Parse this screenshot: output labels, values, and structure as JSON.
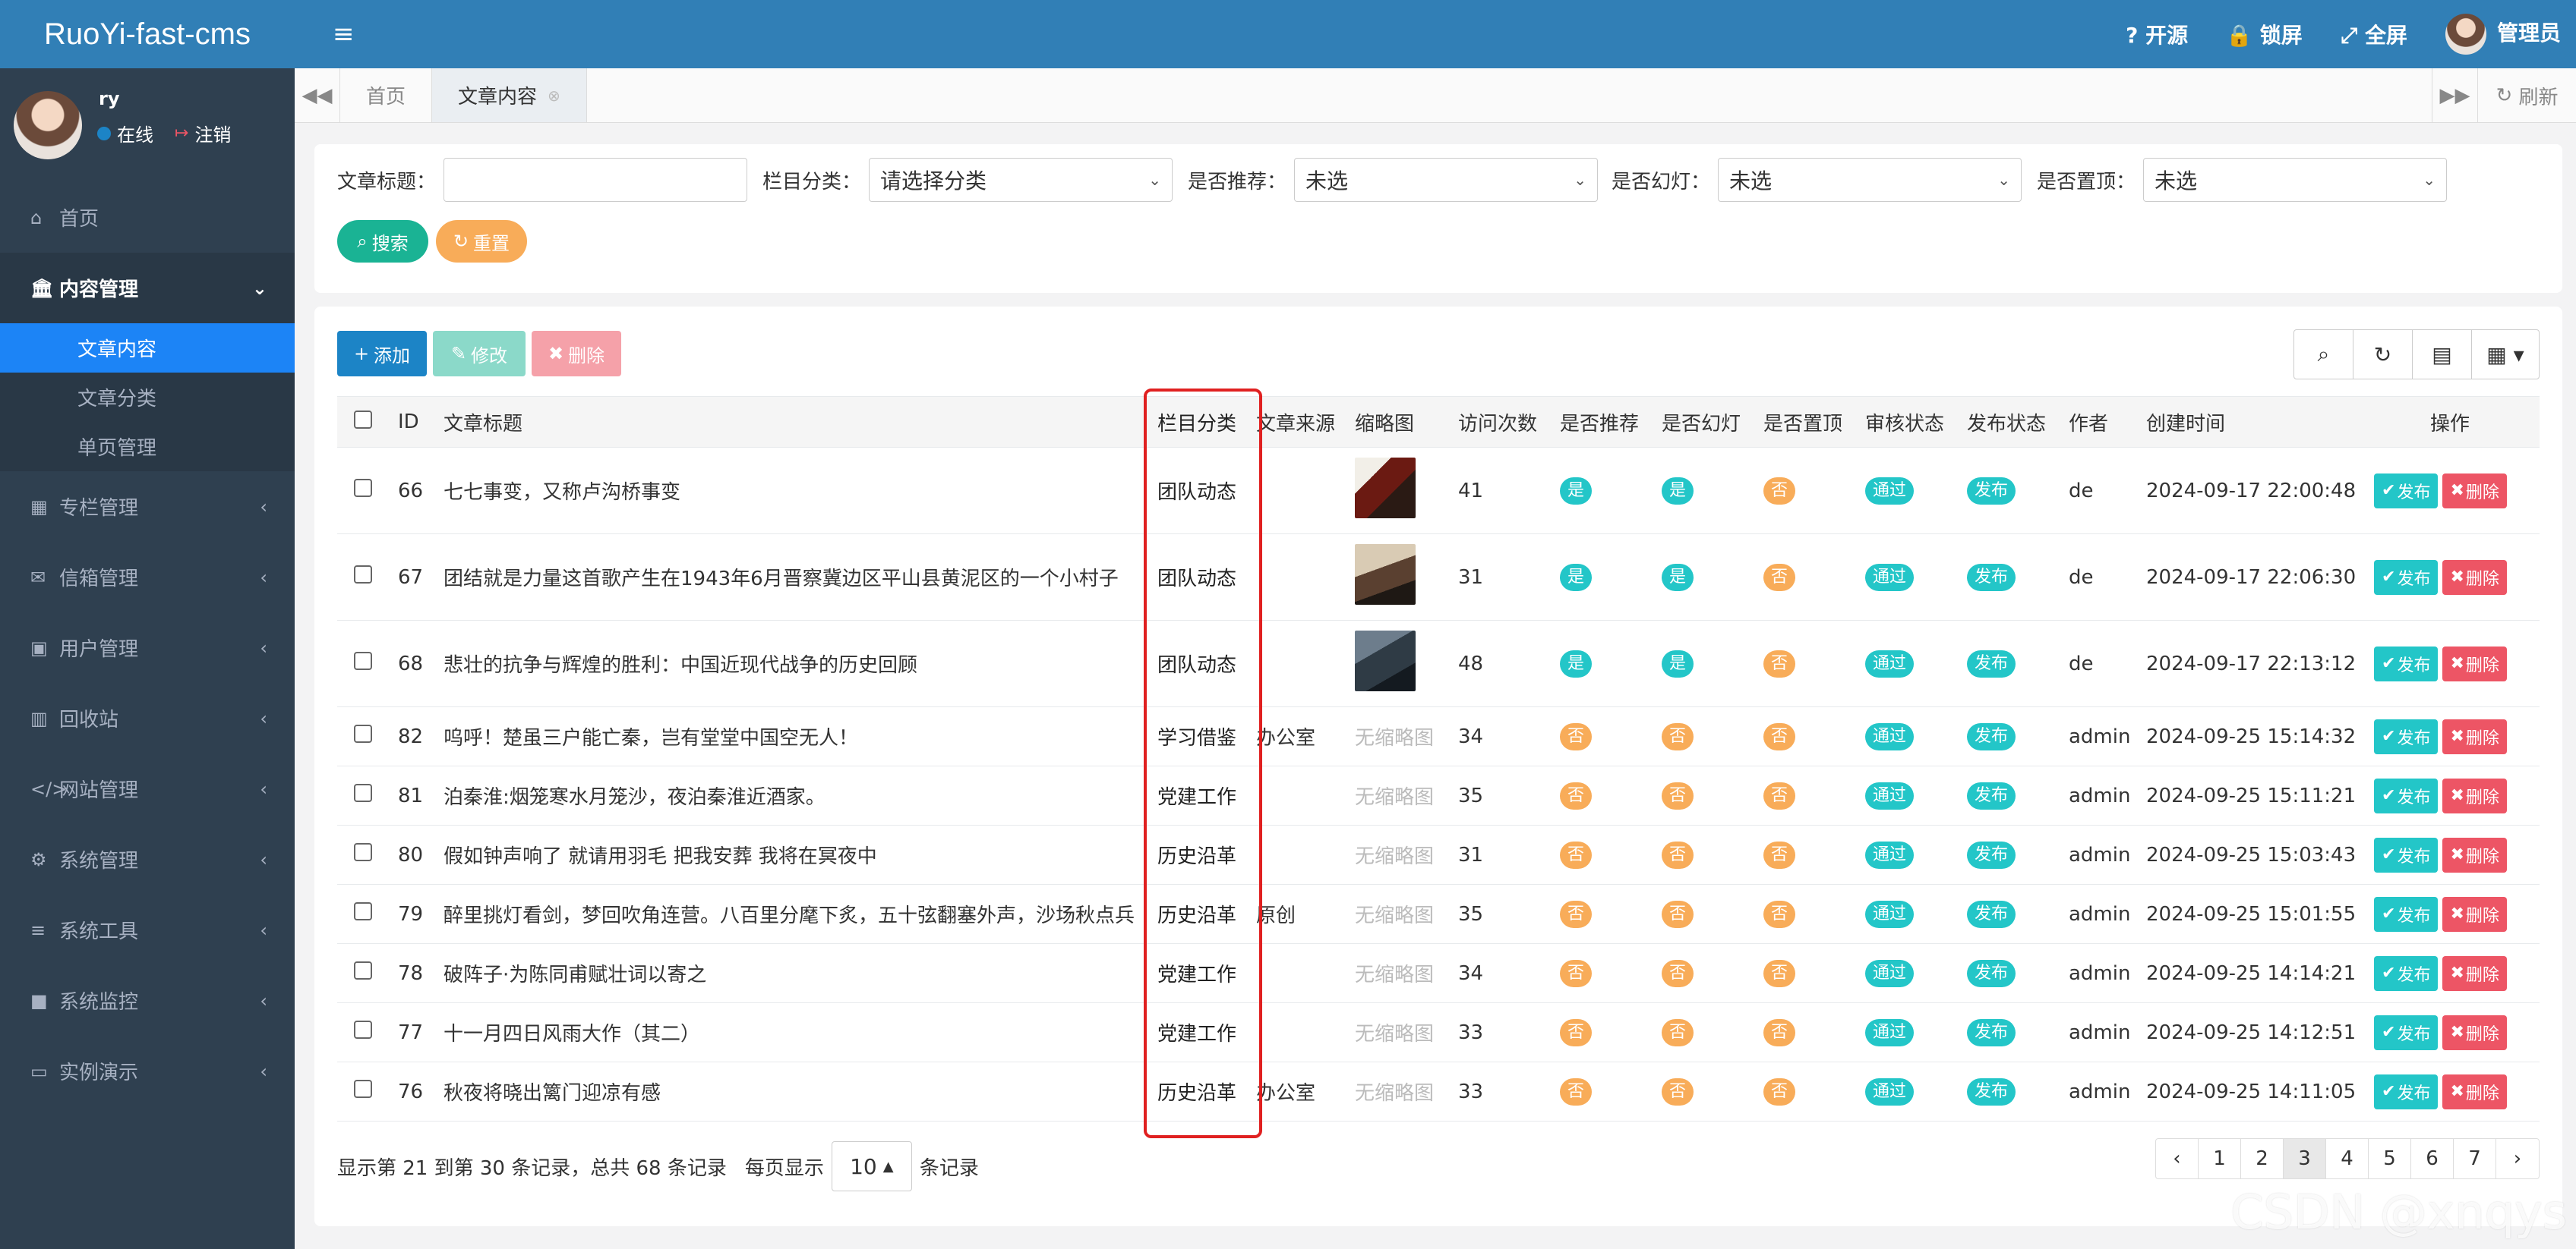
{
  "app": {
    "logo": "RuoYi-fast-cms"
  },
  "user": {
    "name": "ry",
    "status": "在线",
    "logout": "注销"
  },
  "sidebar": {
    "home": "首页",
    "content": "内容管理",
    "content_sub": [
      "文章内容",
      "文章分类",
      "单页管理"
    ],
    "items": [
      "专栏管理",
      "信箱管理",
      "用户管理",
      "回收站",
      "网站管理",
      "系统管理",
      "系统工具",
      "系统监控",
      "实例演示"
    ]
  },
  "topbar": {
    "opensource": "开源",
    "lock": "锁屏",
    "fullscreen": "全屏",
    "admin": "管理员"
  },
  "tabs": {
    "home": "首页",
    "current": "文章内容",
    "refresh": "刷新"
  },
  "search": {
    "title_label": "文章标题：",
    "category_label": "栏目分类：",
    "category_value": "请选择分类",
    "recommend_label": "是否推荐：",
    "recommend_value": "未选",
    "slide_label": "是否幻灯：",
    "slide_value": "未选",
    "top_label": "是否置顶：",
    "top_value": "未选",
    "search_btn": "搜索",
    "reset_btn": "重置"
  },
  "toolbar": {
    "add": "添加",
    "edit": "修改",
    "delete": "删除"
  },
  "table": {
    "headers": {
      "id": "ID",
      "title": "文章标题",
      "category": "栏目分类",
      "source": "文章来源",
      "thumb": "缩略图",
      "visits": "访问次数",
      "recommend": "是否推荐",
      "slide": "是否幻灯",
      "top": "是否置顶",
      "audit": "审核状态",
      "publish": "发布状态",
      "author": "作者",
      "time": "创建时间",
      "ops": "操作"
    },
    "no_thumb": "无缩略图",
    "yes": "是",
    "no": "否",
    "audit_pass": "通过",
    "published": "发布",
    "op_publish": "发布",
    "op_delete": "删除",
    "rows": [
      {
        "id": "66",
        "title": "七七事变，又称卢沟桥事变",
        "category": "团队动态",
        "source": "",
        "thumb": "t1",
        "visits": "41",
        "rec": "是",
        "slide": "是",
        "top": "否",
        "author": "de",
        "time": "2024-09-17 22:00:48"
      },
      {
        "id": "67",
        "title": "团结就是力量这首歌产生在1943年6月晋察冀边区平山县黄泥区的一个小村子",
        "category": "团队动态",
        "source": "",
        "thumb": "t2",
        "visits": "31",
        "rec": "是",
        "slide": "是",
        "top": "否",
        "author": "de",
        "time": "2024-09-17 22:06:30"
      },
      {
        "id": "68",
        "title": "悲壮的抗争与辉煌的胜利：中国近现代战争的历史回顾",
        "category": "团队动态",
        "source": "",
        "thumb": "t3",
        "visits": "48",
        "rec": "是",
        "slide": "是",
        "top": "否",
        "author": "de",
        "time": "2024-09-17 22:13:12"
      },
      {
        "id": "82",
        "title": "呜呼！楚虽三户能亡秦，岂有堂堂中国空无人！",
        "category": "学习借鉴",
        "source": "办公室",
        "thumb": "",
        "visits": "34",
        "rec": "否",
        "slide": "否",
        "top": "否",
        "author": "admin",
        "time": "2024-09-25 15:14:32"
      },
      {
        "id": "81",
        "title": "泊秦淮:烟笼寒水月笼沙，夜泊秦淮近酒家。",
        "category": "党建工作",
        "source": "",
        "thumb": "",
        "visits": "35",
        "rec": "否",
        "slide": "否",
        "top": "否",
        "author": "admin",
        "time": "2024-09-25 15:11:21"
      },
      {
        "id": "80",
        "title": "假如钟声响了 就请用羽毛 把我安葬 我将在冥夜中",
        "category": "历史沿革",
        "source": "",
        "thumb": "",
        "visits": "31",
        "rec": "否",
        "slide": "否",
        "top": "否",
        "author": "admin",
        "time": "2024-09-25 15:03:43"
      },
      {
        "id": "79",
        "title": "醉里挑灯看剑，梦回吹角连营。八百里分麾下炙，五十弦翻塞外声，沙场秋点兵",
        "category": "历史沿革",
        "source": "原创",
        "thumb": "",
        "visits": "35",
        "rec": "否",
        "slide": "否",
        "top": "否",
        "author": "admin",
        "time": "2024-09-25 15:01:55"
      },
      {
        "id": "78",
        "title": "破阵子·为陈同甫赋壮词以寄之",
        "category": "党建工作",
        "source": "",
        "thumb": "",
        "visits": "34",
        "rec": "否",
        "slide": "否",
        "top": "否",
        "author": "admin",
        "time": "2024-09-25 14:14:21"
      },
      {
        "id": "77",
        "title": "十一月四日风雨大作（其二）",
        "category": "党建工作",
        "source": "",
        "thumb": "",
        "visits": "33",
        "rec": "否",
        "slide": "否",
        "top": "否",
        "author": "admin",
        "time": "2024-09-25 14:12:51"
      },
      {
        "id": "76",
        "title": "秋夜将晓出篱门迎凉有感",
        "category": "历史沿革",
        "source": "办公室",
        "thumb": "",
        "visits": "33",
        "rec": "否",
        "slide": "否",
        "top": "否",
        "author": "admin",
        "time": "2024-09-25 14:11:05"
      }
    ]
  },
  "pagination": {
    "info": "显示第 21 到第 30 条记录，总共 68 条记录",
    "per_page_prefix": "每页显示",
    "per_page": "10",
    "per_page_suffix": "条记录",
    "pages": [
      "‹",
      "1",
      "2",
      "3",
      "4",
      "5",
      "6",
      "7",
      "›"
    ],
    "current": "3"
  },
  "watermark": "CSDN @xnqys"
}
